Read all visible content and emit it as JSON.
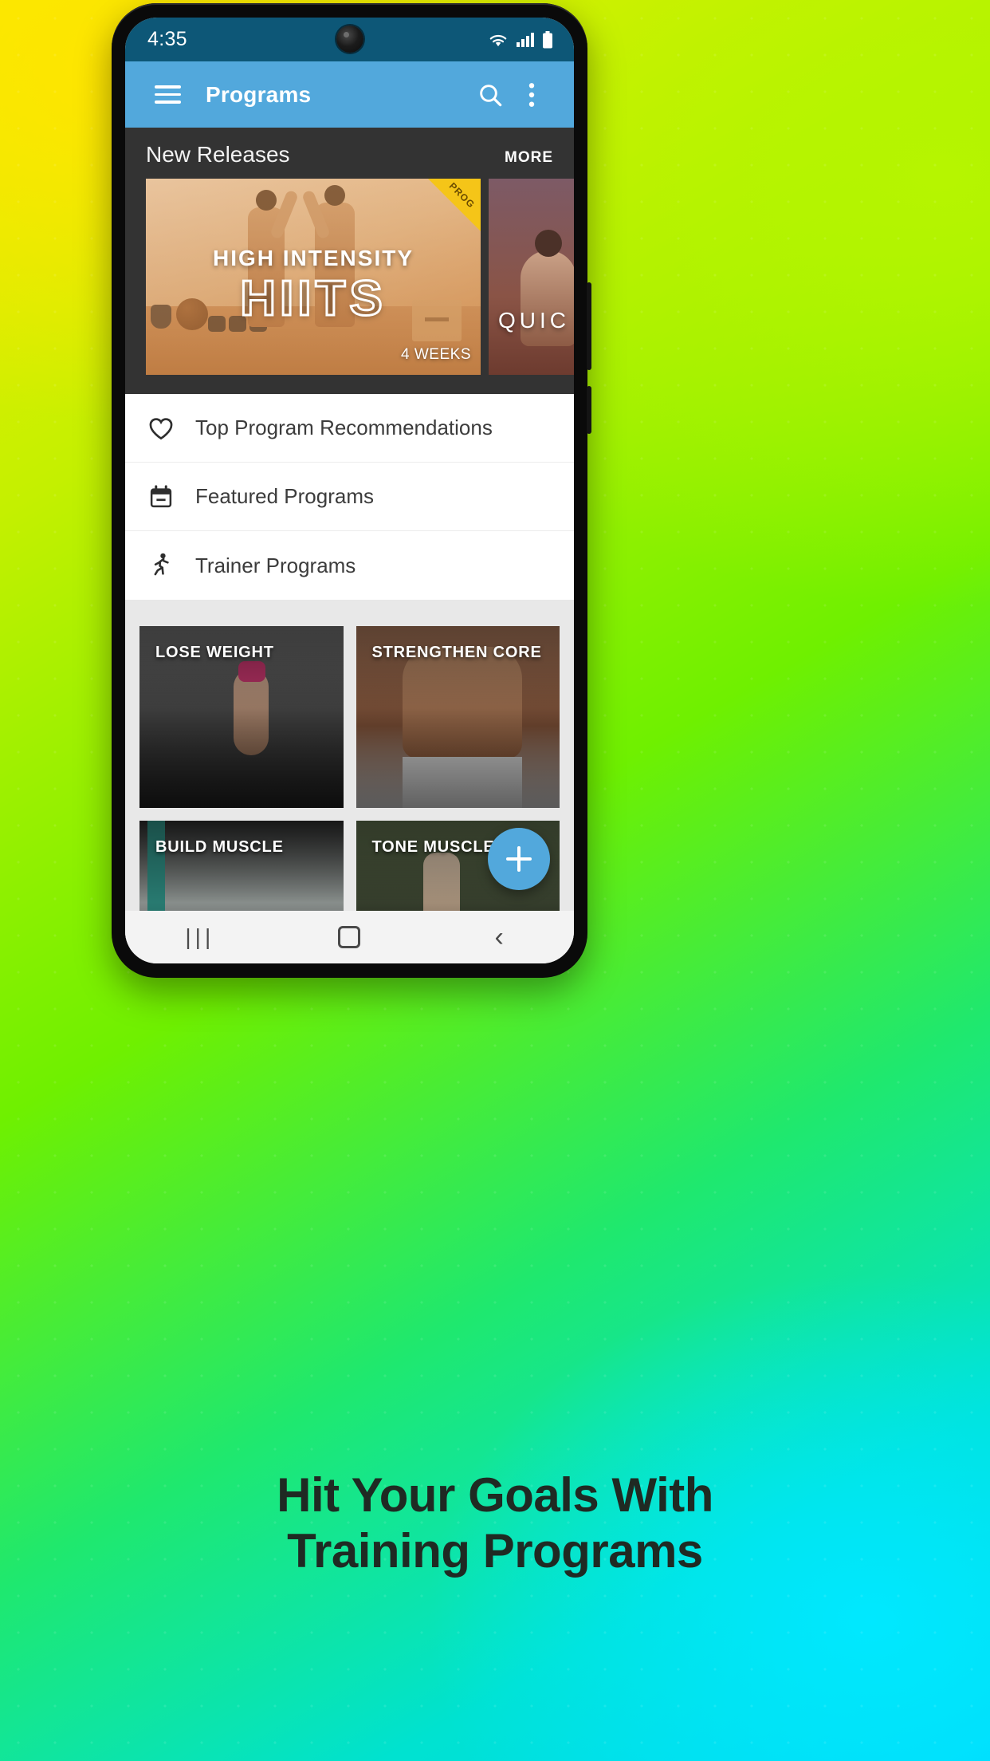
{
  "statusbar": {
    "time": "4:35",
    "icons": [
      "wifi-icon",
      "cellular-signal-icon",
      "battery-icon"
    ]
  },
  "appbar": {
    "menu_icon": "hamburger-menu-icon",
    "title": "Programs",
    "search_icon": "search-icon",
    "overflow_icon": "more-vertical-icon",
    "background_color": "#52a8dc"
  },
  "new_releases": {
    "title": "New Releases",
    "more_label": "MORE",
    "background_color": "#333333",
    "cards": [
      {
        "badge": "PROG",
        "line1": "HIGH INTENSITY",
        "line2": "HIITS",
        "duration": "4 WEEKS"
      },
      {
        "line2": "QUIC"
      }
    ]
  },
  "list": {
    "items": [
      {
        "icon": "heart-icon",
        "label": "Top Program Recommendations"
      },
      {
        "icon": "calendar-icon",
        "label": "Featured Programs"
      },
      {
        "icon": "runner-icon",
        "label": "Trainer Programs"
      }
    ]
  },
  "grid": {
    "tiles": [
      {
        "label": "LOSE WEIGHT"
      },
      {
        "label": "STRENGTHEN CORE"
      },
      {
        "label": "BUILD MUSCLE"
      },
      {
        "label": "TONE MUSCLE"
      }
    ],
    "fab": {
      "icon": "plus-icon",
      "color": "#52a8dc"
    }
  },
  "navbar": {
    "recents_icon": "recents-icon",
    "recents_glyph": "|||",
    "home_icon": "home-icon",
    "back_icon": "back-icon",
    "back_glyph": "‹"
  },
  "promo": {
    "line1": "Hit Your Goals With",
    "line2": "Training Programs"
  }
}
